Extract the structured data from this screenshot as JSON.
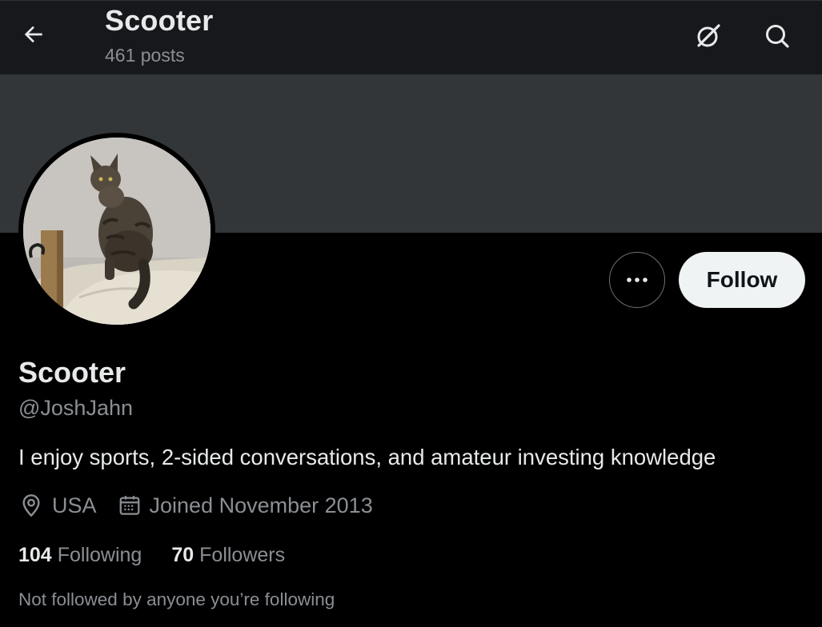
{
  "header": {
    "title": "Scooter",
    "post_count": "461 posts",
    "back_icon": "arrow-left-icon",
    "grok_icon": "grok-icon",
    "search_icon": "search-icon"
  },
  "colors": {
    "background": "#000000",
    "header_bg": "#16181c",
    "banner": "#333639",
    "text_primary": "#e7e9ea",
    "text_secondary": "#8b8f94",
    "follow_button_bg": "#eff3f4",
    "follow_button_text": "#0f1419"
  },
  "profile": {
    "display_name": "Scooter",
    "handle": "@JoshJahn",
    "bio": "I enjoy sports, 2-sided conversations, and amateur investing knowledge",
    "location": "USA",
    "location_icon": "location-pin-icon",
    "joined": "Joined November 2013",
    "calendar_icon": "calendar-icon",
    "following_count": "104",
    "following_label": "Following",
    "followers_count": "70",
    "followers_label": "Followers",
    "not_followed_text": "Not followed by anyone you’re following"
  },
  "actions": {
    "more_icon": "more-dots-icon",
    "follow_label": "Follow"
  }
}
